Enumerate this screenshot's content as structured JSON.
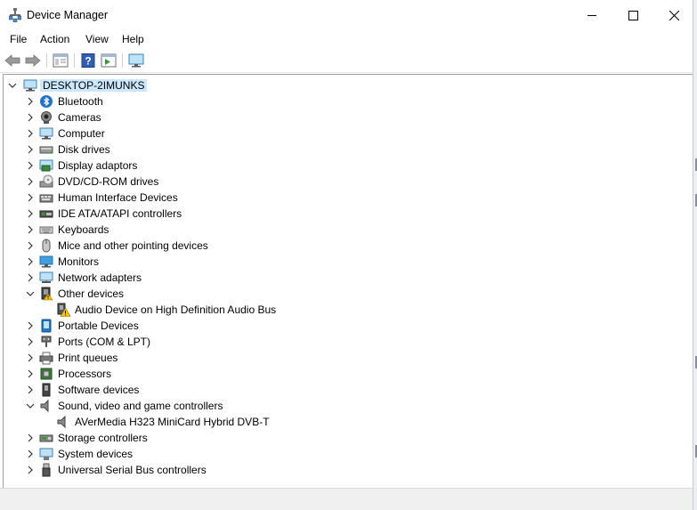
{
  "window": {
    "title": "Device Manager"
  },
  "menu": {
    "items": [
      "File",
      "Action",
      "View",
      "Help"
    ]
  },
  "toolbar": {
    "buttons": [
      "back-icon",
      "forward-icon",
      "properties-icon",
      "help-icon",
      "run-icon",
      "monitor-icon"
    ]
  },
  "tree": {
    "root": "DESKTOP-2IMUNKS",
    "categories": [
      {
        "label": "Bluetooth",
        "icon": "bluetooth-icon",
        "expanded": false
      },
      {
        "label": "Cameras",
        "icon": "camera-icon",
        "expanded": false
      },
      {
        "label": "Computer",
        "icon": "computer-icon",
        "expanded": false
      },
      {
        "label": "Disk drives",
        "icon": "disk-drive-icon",
        "expanded": false
      },
      {
        "label": "Display adaptors",
        "icon": "display-adapter-icon",
        "expanded": false
      },
      {
        "label": "DVD/CD-ROM drives",
        "icon": "dvd-drive-icon",
        "expanded": false
      },
      {
        "label": "Human Interface Devices",
        "icon": "hid-icon",
        "expanded": false
      },
      {
        "label": "IDE ATA/ATAPI controllers",
        "icon": "ide-controller-icon",
        "expanded": false
      },
      {
        "label": "Keyboards",
        "icon": "keyboard-icon",
        "expanded": false
      },
      {
        "label": "Mice and other pointing devices",
        "icon": "mouse-icon",
        "expanded": false
      },
      {
        "label": "Monitors",
        "icon": "monitor-icon",
        "expanded": false
      },
      {
        "label": "Network adapters",
        "icon": "network-icon",
        "expanded": false
      },
      {
        "label": "Other devices",
        "icon": "other-devices-icon",
        "expanded": true,
        "children": [
          {
            "label": "Audio Device on High Definition Audio Bus",
            "icon": "warning-device-icon"
          }
        ]
      },
      {
        "label": "Portable Devices",
        "icon": "portable-device-icon",
        "expanded": false
      },
      {
        "label": "Ports (COM & LPT)",
        "icon": "port-icon",
        "expanded": false
      },
      {
        "label": "Print queues",
        "icon": "printer-icon",
        "expanded": false
      },
      {
        "label": "Processors",
        "icon": "processor-icon",
        "expanded": false
      },
      {
        "label": "Software devices",
        "icon": "software-device-icon",
        "expanded": false
      },
      {
        "label": "Sound, video and game controllers",
        "icon": "speaker-icon",
        "expanded": true,
        "children": [
          {
            "label": "AVerMedia H323 MiniCard Hybrid DVB-T",
            "icon": "speaker-icon"
          }
        ]
      },
      {
        "label": "Storage controllers",
        "icon": "storage-controller-icon",
        "expanded": false
      },
      {
        "label": "System devices",
        "icon": "system-device-icon",
        "expanded": false
      },
      {
        "label": "Universal Serial Bus controllers",
        "icon": "usb-icon",
        "expanded": false
      }
    ]
  },
  "colors": {
    "selection": "#cce8ff",
    "accent": "#0078d7",
    "warning": "#f7c400"
  }
}
